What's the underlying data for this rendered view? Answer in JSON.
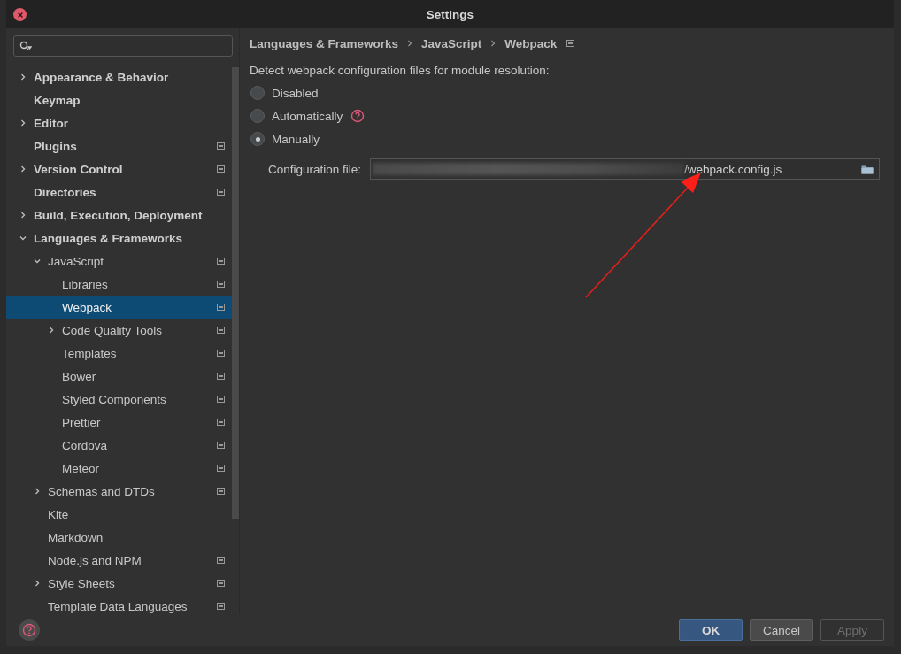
{
  "window": {
    "title": "Settings"
  },
  "tree": [
    {
      "label": "Appearance & Behavior",
      "expanded": false,
      "selected": false
    },
    {
      "label": "Keymap",
      "selected": false
    },
    {
      "label": "Editor",
      "expanded": false,
      "selected": false
    },
    {
      "label": "Plugins",
      "selected": false,
      "project_icon": true
    },
    {
      "label": "Version Control",
      "expanded": false,
      "selected": false,
      "project_icon": true
    },
    {
      "label": "Directories",
      "selected": false,
      "project_icon": true
    },
    {
      "label": "Build, Execution, Deployment",
      "expanded": false,
      "selected": false
    },
    {
      "label": "Languages & Frameworks",
      "expanded": true,
      "selected": false,
      "children": [
        {
          "label": "JavaScript",
          "expanded": true,
          "selected": false,
          "project_icon": true,
          "children": [
            {
              "label": "Libraries",
              "selected": false,
              "project_icon": true
            },
            {
              "label": "Webpack",
              "selected": true,
              "project_icon": true
            },
            {
              "label": "Code Quality Tools",
              "expanded": false,
              "selected": false,
              "project_icon": true
            },
            {
              "label": "Templates",
              "selected": false,
              "project_icon": true
            },
            {
              "label": "Bower",
              "selected": false,
              "project_icon": true
            },
            {
              "label": "Styled Components",
              "selected": false,
              "project_icon": true
            },
            {
              "label": "Prettier",
              "selected": false,
              "project_icon": true
            },
            {
              "label": "Cordova",
              "selected": false,
              "project_icon": true
            },
            {
              "label": "Meteor",
              "selected": false,
              "project_icon": true
            }
          ]
        },
        {
          "label": "Schemas and DTDs",
          "expanded": false,
          "selected": false,
          "project_icon": true
        },
        {
          "label": "Kite",
          "selected": false
        },
        {
          "label": "Markdown",
          "selected": false
        },
        {
          "label": "Node.js and NPM",
          "selected": false,
          "project_icon": true
        },
        {
          "label": "Style Sheets",
          "expanded": false,
          "selected": false,
          "project_icon": true
        },
        {
          "label": "Template Data Languages",
          "selected": false,
          "project_icon": true
        }
      ]
    }
  ],
  "breadcrumb": [
    "Languages & Frameworks",
    "JavaScript",
    "Webpack"
  ],
  "description": "Detect webpack configuration files for module resolution:",
  "options": [
    {
      "label": "Disabled",
      "selected": false
    },
    {
      "label": "Automatically",
      "selected": false,
      "help": true
    },
    {
      "label": "Manually",
      "selected": true
    }
  ],
  "config_file": {
    "label": "Configuration file:",
    "value": "/webpack.config.js"
  },
  "buttons": [
    {
      "label": "OK",
      "kind": "primary",
      "disabled": false
    },
    {
      "label": "Cancel",
      "kind": "normal",
      "disabled": false
    },
    {
      "label": "Apply",
      "kind": "normal",
      "disabled": true
    }
  ]
}
